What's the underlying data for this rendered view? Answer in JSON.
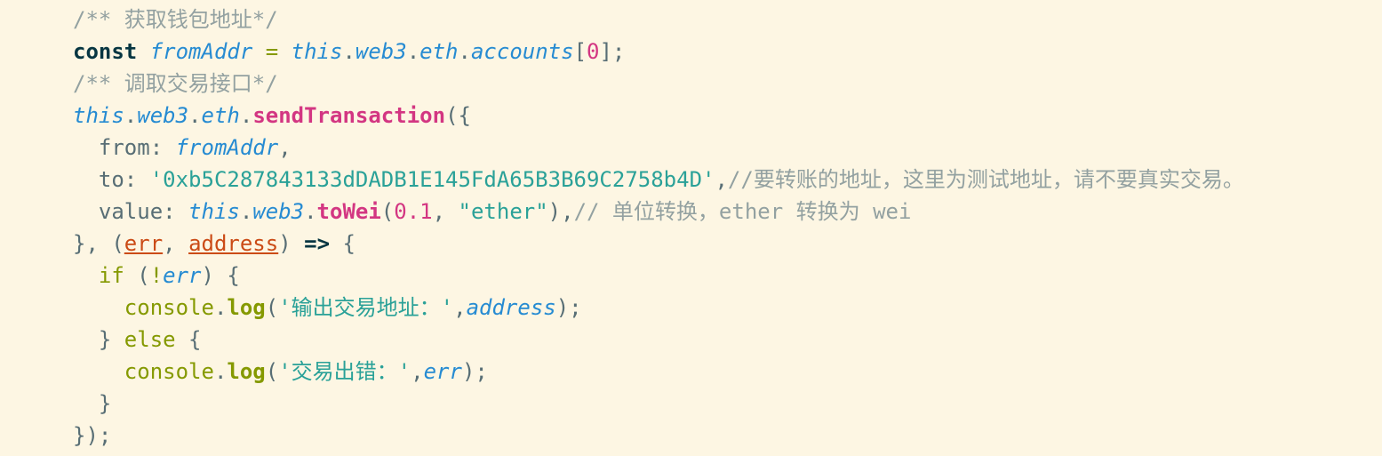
{
  "editor": {
    "theme_colors": {
      "background": "#fdf6e3",
      "comment": "#93a1a1",
      "keyword": "#073642",
      "variable": "#268bd2",
      "number": "#d33682",
      "string": "#2aa198",
      "parameter": "#cb4b16",
      "control": "#859900"
    },
    "lines": [
      {
        "tokens": [
          {
            "type": "comment",
            "text": "/** 获取钱包地址*/"
          }
        ]
      },
      {
        "tokens": [
          {
            "type": "keyword",
            "text": "const"
          },
          {
            "type": "punct",
            "text": " "
          },
          {
            "type": "var",
            "text": "fromAddr"
          },
          {
            "type": "op",
            "text": " = "
          },
          {
            "type": "var",
            "text": "this"
          },
          {
            "type": "punct",
            "text": "."
          },
          {
            "type": "var",
            "text": "web3"
          },
          {
            "type": "punct",
            "text": "."
          },
          {
            "type": "var",
            "text": "eth"
          },
          {
            "type": "punct",
            "text": "."
          },
          {
            "type": "var",
            "text": "accounts"
          },
          {
            "type": "punct",
            "text": "["
          },
          {
            "type": "num",
            "text": "0"
          },
          {
            "type": "punct",
            "text": "];"
          }
        ]
      },
      {
        "tokens": [
          {
            "type": "comment",
            "text": "/** 调取交易接口*/"
          }
        ]
      },
      {
        "tokens": [
          {
            "type": "var",
            "text": "this"
          },
          {
            "type": "punct",
            "text": "."
          },
          {
            "type": "var",
            "text": "web3"
          },
          {
            "type": "punct",
            "text": "."
          },
          {
            "type": "var",
            "text": "eth"
          },
          {
            "type": "punct",
            "text": "."
          },
          {
            "type": "fn",
            "text": "sendTransaction"
          },
          {
            "type": "punct",
            "text": "({"
          }
        ]
      },
      {
        "tokens": [
          {
            "type": "prop",
            "text": "  from: "
          },
          {
            "type": "var",
            "text": "fromAddr"
          },
          {
            "type": "punct",
            "text": ","
          }
        ]
      },
      {
        "tokens": [
          {
            "type": "prop",
            "text": "  to: "
          },
          {
            "type": "str",
            "text": "'0xb5C287843133dDADB1E145FdA65B3B69C2758b4D'"
          },
          {
            "type": "punct",
            "text": ","
          },
          {
            "type": "comment",
            "text": "//要转账的地址，这里为测试地址，请不要真实交易。"
          }
        ]
      },
      {
        "tokens": [
          {
            "type": "prop",
            "text": "  value: "
          },
          {
            "type": "var",
            "text": "this"
          },
          {
            "type": "punct",
            "text": "."
          },
          {
            "type": "var",
            "text": "web3"
          },
          {
            "type": "punct",
            "text": "."
          },
          {
            "type": "fn",
            "text": "toWei"
          },
          {
            "type": "punct",
            "text": "("
          },
          {
            "type": "num",
            "text": "0.1"
          },
          {
            "type": "punct",
            "text": ", "
          },
          {
            "type": "str",
            "text": "\"ether\""
          },
          {
            "type": "punct",
            "text": "),"
          },
          {
            "type": "comment",
            "text": "// 单位转换，ether 转换为 wei"
          }
        ]
      },
      {
        "tokens": [
          {
            "type": "punct",
            "text": "}, ("
          },
          {
            "type": "param",
            "text": "err"
          },
          {
            "type": "punct",
            "text": ", "
          },
          {
            "type": "param",
            "text": "address"
          },
          {
            "type": "punct",
            "text": ") "
          },
          {
            "type": "arrow",
            "text": "=>"
          },
          {
            "type": "punct",
            "text": " {"
          }
        ]
      },
      {
        "tokens": [
          {
            "type": "kw2",
            "text": "  if"
          },
          {
            "type": "punct",
            "text": " ("
          },
          {
            "type": "kw2",
            "text": "!"
          },
          {
            "type": "var",
            "text": "err"
          },
          {
            "type": "punct",
            "text": ") {"
          }
        ]
      },
      {
        "tokens": [
          {
            "type": "console",
            "text": "    console"
          },
          {
            "type": "punct",
            "text": "."
          },
          {
            "type": "log",
            "text": "log"
          },
          {
            "type": "punct",
            "text": "("
          },
          {
            "type": "str",
            "text": "'输出交易地址：'"
          },
          {
            "type": "punct",
            "text": ","
          },
          {
            "type": "var",
            "text": "address"
          },
          {
            "type": "punct",
            "text": ");"
          }
        ]
      },
      {
        "tokens": [
          {
            "type": "punct",
            "text": "  } "
          },
          {
            "type": "kw2",
            "text": "else"
          },
          {
            "type": "punct",
            "text": " {"
          }
        ]
      },
      {
        "tokens": [
          {
            "type": "console",
            "text": "    console"
          },
          {
            "type": "punct",
            "text": "."
          },
          {
            "type": "log",
            "text": "log"
          },
          {
            "type": "punct",
            "text": "("
          },
          {
            "type": "str",
            "text": "'交易出错：'"
          },
          {
            "type": "punct",
            "text": ","
          },
          {
            "type": "var",
            "text": "err"
          },
          {
            "type": "punct",
            "text": ");"
          }
        ]
      },
      {
        "tokens": [
          {
            "type": "punct",
            "text": "  }"
          }
        ]
      },
      {
        "tokens": [
          {
            "type": "punct",
            "text": "});"
          }
        ]
      }
    ]
  }
}
